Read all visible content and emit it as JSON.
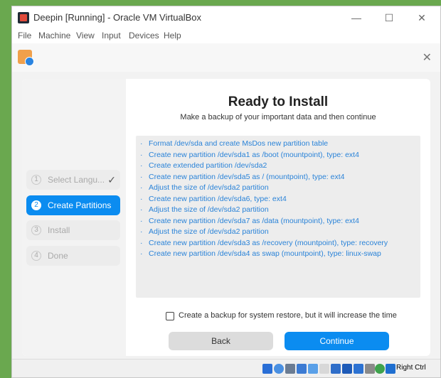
{
  "window": {
    "title": "Deepin [Running] - Oracle VM VirtualBox",
    "minimize_glyph": "—",
    "maximize_glyph": "☐",
    "close_glyph": "✕"
  },
  "menu": [
    "File",
    "Machine",
    "View",
    "Input",
    "Devices",
    "Help"
  ],
  "installer": {
    "close_glyph": "✕",
    "steps": [
      {
        "num": "1",
        "label": "Select Langu...",
        "state": "done",
        "check": "✓"
      },
      {
        "num": "2",
        "label": "Create Partitions",
        "state": "active"
      },
      {
        "num": "3",
        "label": "Install",
        "state": "pending"
      },
      {
        "num": "4",
        "label": "Done",
        "state": "pending"
      }
    ],
    "heading": "Ready to Install",
    "subheading": "Make a backup of your important data and then continue",
    "operations": [
      "Format /dev/sda and create MsDos new partition table",
      "Create new partition /dev/sda1 as /boot (mountpoint), type: ext4",
      "Create extended partition /dev/sda2",
      "Create new partition /dev/sda5 as / (mountpoint), type: ext4",
      "Adjust the size of /dev/sda2 partition",
      "Create new partition /dev/sda6, type: ext4",
      "Adjust the size of /dev/sda2 partition",
      "Create new partition /dev/sda7 as /data (mountpoint), type: ext4",
      "Adjust the size of /dev/sda2 partition",
      "Create new partition /dev/sda3 as /recovery (mountpoint), type: recovery",
      "Create new partition /dev/sda4 as swap (mountpoint), type: linux-swap"
    ],
    "backup_label": "Create a backup for system restore, but it will increase the time",
    "backup_checked": false,
    "back_label": "Back",
    "continue_label": "Continue"
  },
  "statusbar": {
    "icons": [
      "hard-disk-icon",
      "optical-drive-icon",
      "audio-icon",
      "network-icon",
      "usb-icon",
      "shared-folder-icon",
      "display-icon",
      "video-capture-icon",
      "recording-icon",
      "cpu-icon",
      "mouse-integration-icon",
      "host-key-arrow-icon"
    ],
    "host_key": "Right Ctrl"
  },
  "colors": {
    "accent": "#0b8cf0",
    "op_text": "#2a83d8",
    "desktop_border": "#6aa84f"
  }
}
